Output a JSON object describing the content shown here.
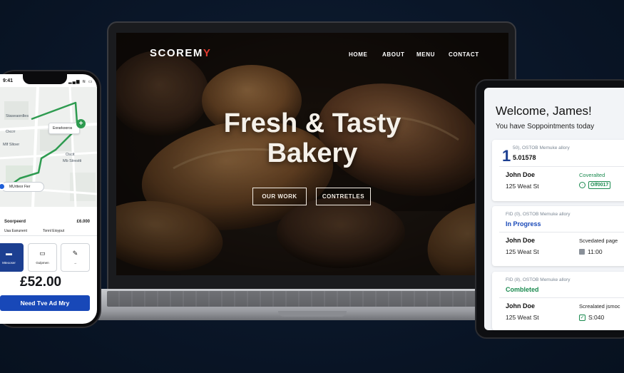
{
  "laptop": {
    "logo_main": "SCOREM",
    "logo_accent": "Y",
    "nav": [
      "HOME",
      "ABOUT",
      "MENU",
      "CONTACT"
    ],
    "hero_line1": "Fresh & Tasty",
    "hero_line2": "Bakery",
    "btn_primary": "OUR WORK",
    "btn_secondary": "CONTRETLES"
  },
  "phone": {
    "status_time": "9:41",
    "status_icons": "▂▄▆ ≋ ▭",
    "map_labels": [
      "Staseaordles",
      "Oxcrr",
      "Mlf Sltoer",
      "Oscit",
      "Mb Strestti"
    ],
    "map_card": "Eorarkooros",
    "map_pill": "MUrtteor Fier",
    "sheet_row1_left": "Soorpeerd",
    "sheet_row1_right": "£6.000",
    "sheet_row2_left": "Uaa Eanunent",
    "sheet_row2_right": "Tonnl Eioyput",
    "options": [
      {
        "label": "Mteooser",
        "glyph": "▬"
      },
      {
        "label": "Gulpmen",
        "glyph": "▭"
      },
      {
        "label": "→",
        "glyph": "✎"
      }
    ],
    "price": "£52.00",
    "cta": "Need Tve Ad Mry"
  },
  "tablet": {
    "welcome": "Welcome, James!",
    "subtitle": "You have Soppointments today",
    "cards": [
      {
        "number": "1",
        "meta": "50), OSTOB Memuke allory",
        "id": "5.01578",
        "name": "John Doe",
        "address": "125 Weat St",
        "right_label": "Coveralted",
        "right_value": "Olf0017"
      },
      {
        "meta": "FID (0), OSTOB Memuke allory",
        "status": "In Progress",
        "name": "John Doe",
        "address": "125 Weat St",
        "right_label": "Scvedated page",
        "right_value": "11:00"
      },
      {
        "meta": "FID (8), OSTOB Memuke allory",
        "status": "Combleted",
        "name": "John Doe",
        "address": "125 Weat St",
        "right_label": "Screalated jsmoc",
        "right_value": "S:040"
      }
    ]
  },
  "colors": {
    "background": "#0a1628",
    "accent_red": "#e23a2f",
    "brand_blue": "#1848b8",
    "navy": "#1c3f91",
    "success_green": "#1a8a4f"
  }
}
